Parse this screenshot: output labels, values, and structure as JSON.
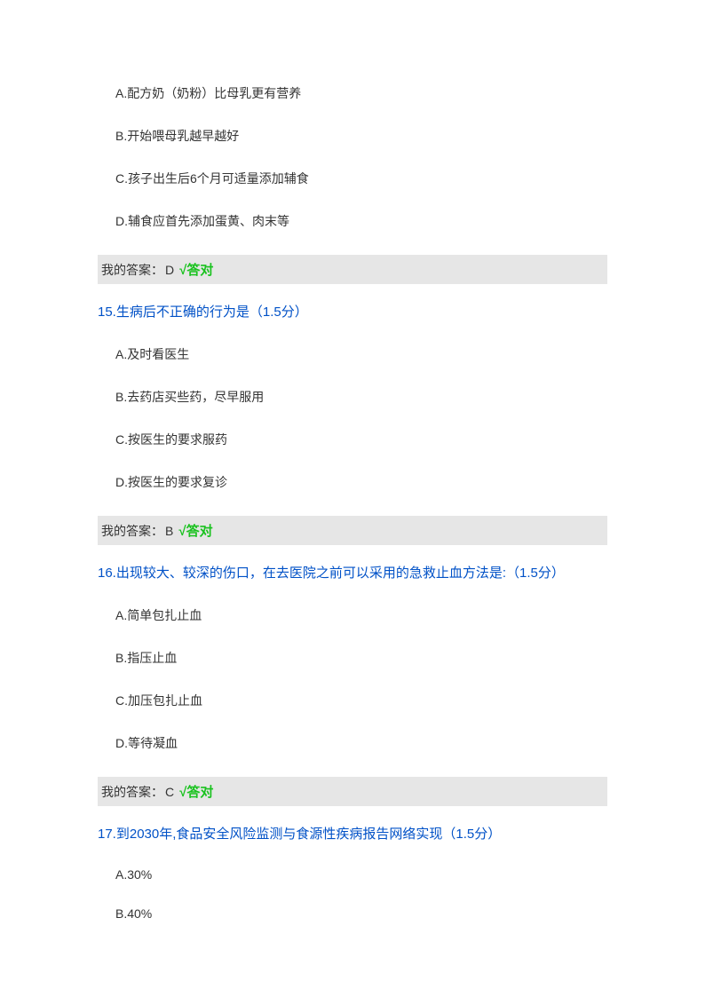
{
  "q14": {
    "options": {
      "A": "A.配方奶（奶粉）比母乳更有营养",
      "B": "B.开始喂母乳越早越好",
      "C": "C.孩子出生后6个月可适量添加辅食",
      "D": "D.辅食应首先添加蛋黄、肉末等"
    },
    "answer_label": "我的答案：",
    "answer_letter": "D",
    "correct_text": "√答对"
  },
  "q15": {
    "title": "15.生病后不正确的行为是（1.5分）",
    "options": {
      "A": "A.及时看医生",
      "B": "B.去药店买些药，尽早服用",
      "C": "C.按医生的要求服药",
      "D": "D.按医生的要求复诊"
    },
    "answer_label": "我的答案：",
    "answer_letter": "B",
    "correct_text": "√答对"
  },
  "q16": {
    "title": "16.出现较大、较深的伤口，在去医院之前可以采用的急救止血方法是:（1.5分）",
    "options": {
      "A": "A.简单包扎止血",
      "B": "B.指压止血",
      "C": "C.加压包扎止血",
      "D": "D.等待凝血"
    },
    "answer_label": "我的答案：",
    "answer_letter": "C",
    "correct_text": "√答对"
  },
  "q17": {
    "title": "17.到2030年,食品安全风险监测与食源性疾病报告网络实现（1.5分）",
    "options": {
      "A": "A.30%",
      "B": "B.40%"
    }
  }
}
